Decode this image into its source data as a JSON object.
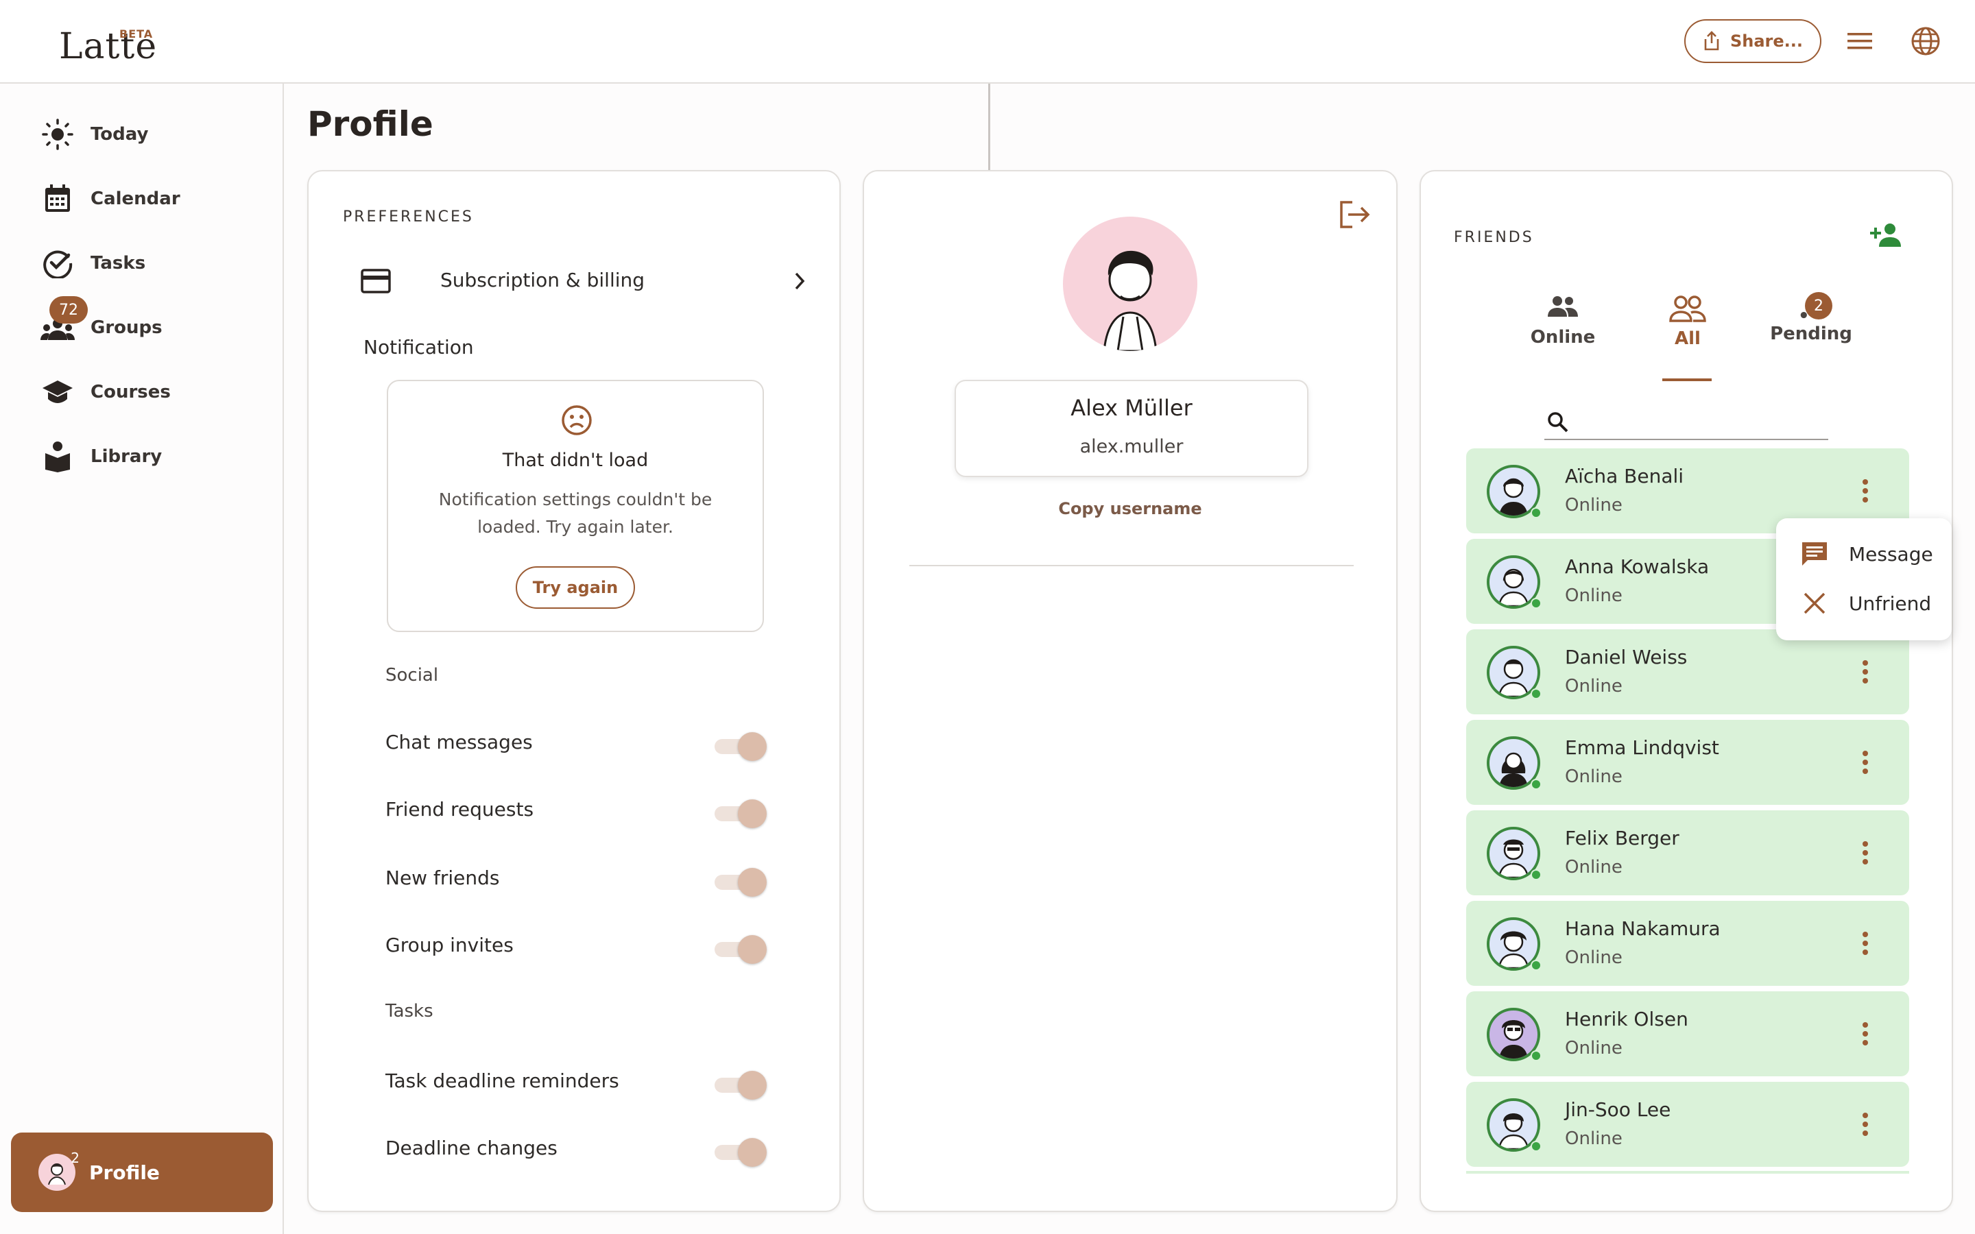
{
  "header": {
    "logo_text": "Latte",
    "beta_label": "BETA",
    "share_label": "Share..."
  },
  "sidebar": {
    "items": [
      {
        "label": "Today",
        "icon": "sun-icon"
      },
      {
        "label": "Calendar",
        "icon": "calendar-icon"
      },
      {
        "label": "Tasks",
        "icon": "check-circle-icon"
      },
      {
        "label": "Groups",
        "icon": "groups-icon",
        "badge": "72"
      },
      {
        "label": "Courses",
        "icon": "graduation-cap-icon"
      },
      {
        "label": "Library",
        "icon": "book-reader-icon"
      }
    ],
    "profile_label": "Profile",
    "profile_badge": "2"
  },
  "page_title": "Profile",
  "preferences": {
    "title": "PREFERENCES",
    "subscription_label": "Subscription & billing",
    "notification_label": "Notification",
    "error": {
      "title": "That didn't load",
      "message_line1": "Notification settings couldn't be",
      "message_line2": "loaded. Try again later.",
      "button": "Try again"
    },
    "social_label": "Social",
    "toggles": [
      {
        "label": "Chat messages"
      },
      {
        "label": "Friend requests"
      },
      {
        "label": "New friends"
      },
      {
        "label": "Group invites"
      }
    ],
    "tasks_label": "Tasks",
    "task_toggles": [
      {
        "label": "Task deadline reminders"
      },
      {
        "label": "Deadline changes"
      }
    ]
  },
  "profile": {
    "name": "Alex Müller",
    "username": "alex.muller",
    "copy_label": "Copy username"
  },
  "friends": {
    "title": "FRIENDS",
    "tabs": [
      {
        "label": "Online"
      },
      {
        "label": "All"
      },
      {
        "label": "Pending",
        "badge": "2"
      }
    ],
    "search_placeholder": "",
    "list": [
      {
        "name": "Aïcha Benali",
        "status": "Online"
      },
      {
        "name": "Anna Kowalska",
        "status": "Online"
      },
      {
        "name": "Daniel Weiss",
        "status": "Online"
      },
      {
        "name": "Emma Lindqvist",
        "status": "Online"
      },
      {
        "name": "Felix Berger",
        "status": "Online"
      },
      {
        "name": "Hana Nakamura",
        "status": "Online"
      },
      {
        "name": "Henrik Olsen",
        "status": "Online"
      },
      {
        "name": "Jin-Soo Lee",
        "status": "Online"
      }
    ],
    "context_menu": {
      "message": "Message",
      "unfriend": "Unfriend"
    }
  },
  "colors": {
    "accent": "#9b5b33",
    "friend_row_bg": "#daf2d9",
    "online_green": "#3ba544",
    "add_friend_green": "#2e8b3a"
  }
}
